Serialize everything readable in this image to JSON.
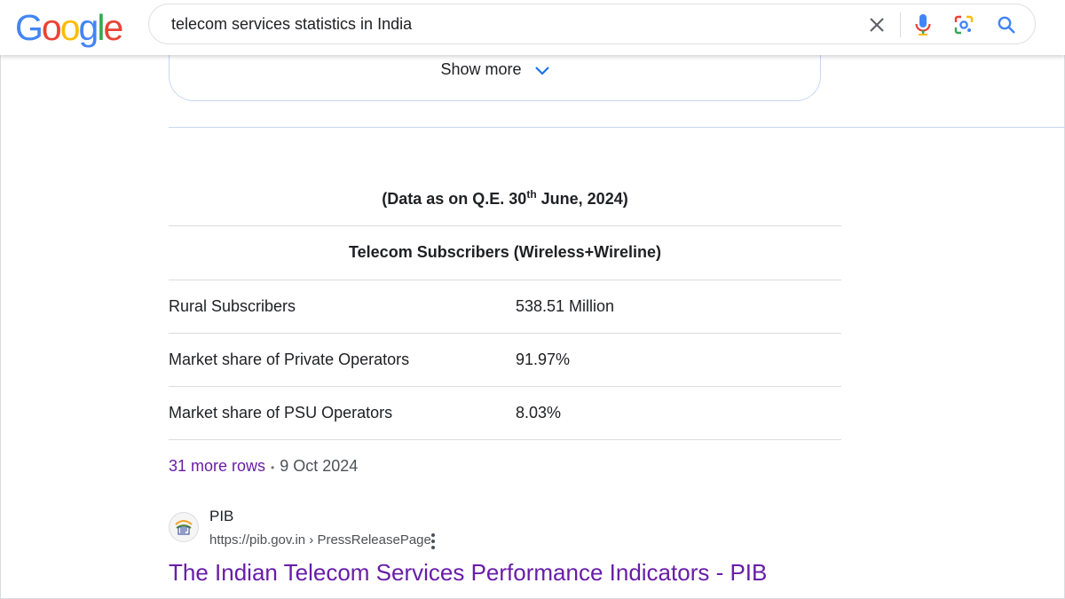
{
  "header": {
    "logo_letters": [
      "G",
      "o",
      "o",
      "g",
      "l",
      "e"
    ],
    "logo_colors": [
      "#4285F4",
      "#EA4335",
      "#FBBC05",
      "#4285F4",
      "#34A853",
      "#EA4335"
    ],
    "search_query": "telecom services statistics in India",
    "icons": [
      "clear-icon",
      "microphone-icon",
      "lens-icon",
      "search-icon"
    ]
  },
  "show_more": {
    "label": "Show more"
  },
  "snippet": {
    "date_prefix": "(Data as on Q.E. 30",
    "date_sup": "th",
    "date_suffix": " June, 2024)",
    "table_heading": "Telecom Subscribers (Wireless+Wireline)",
    "rows": [
      {
        "label": "Rural Subscribers",
        "value": "538.51 Million"
      },
      {
        "label": "Market share of Private Operators",
        "value": "91.97%"
      },
      {
        "label": "Market share of PSU Operators",
        "value": "8.03%"
      }
    ],
    "more_rows": "31 more rows",
    "separator": "•",
    "date": "9 Oct 2024"
  },
  "source": {
    "site_name": "PIB",
    "url": "https://pib.gov.in › PressReleasePage",
    "title": "The Indian Telecom Services Performance Indicators - PIB"
  },
  "colors": {
    "link_visited": "#681da8",
    "accent_blue": "#1a73e8"
  }
}
